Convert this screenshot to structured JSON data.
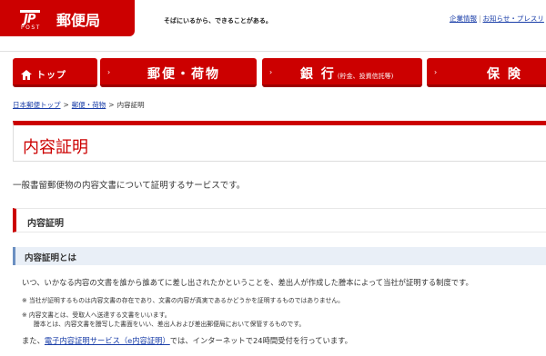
{
  "header": {
    "logo_mark": "JP",
    "logo_post": "POST",
    "logo_name": "郵便局",
    "tagline": "そばにいるから、できることがある。",
    "links": [
      "企業情報",
      "お知らせ・プレスリ"
    ],
    "brand_color": "#cc0000"
  },
  "nav": {
    "items": [
      {
        "label": "トップ",
        "icon": "home-icon"
      },
      {
        "label": "郵便・荷物",
        "icon": "arrow-icon"
      },
      {
        "label": "銀 行",
        "sub": "(貯金、投資信託等)",
        "icon": "arrow-icon"
      },
      {
        "label": "保 険",
        "icon": "arrow-icon"
      }
    ]
  },
  "breadcrumb": {
    "items": [
      "日本郵便トップ",
      "郵便・荷物"
    ],
    "current": "内容証明"
  },
  "page": {
    "title": "内容証明",
    "lead": "一般書留郵便物の内容文書について証明するサービスです。",
    "section_heading": "内容証明",
    "subsection_heading": "内容証明とは",
    "body": "いつ、いかなる内容の文書を誰から誰あてに差し出されたかということを、差出人が作成した謄本によって当社が証明する制度です。",
    "note1": "※ 当社が証明するものは内容文書の存在であり、文書の内容が真実であるかどうかを証明するものではありません。",
    "note2": "※ 内容文書とは、受取人へ送達する文書をいいます。",
    "note2b": "謄本とは、内容文書を謄写した書面をいい、差出人および差出郵便局において保管するものです。",
    "last_prefix": "また、",
    "last_link": "電子内容証明サービス（e内容証明）",
    "last_suffix": "では、インターネットで24時間受付を行っています。"
  }
}
